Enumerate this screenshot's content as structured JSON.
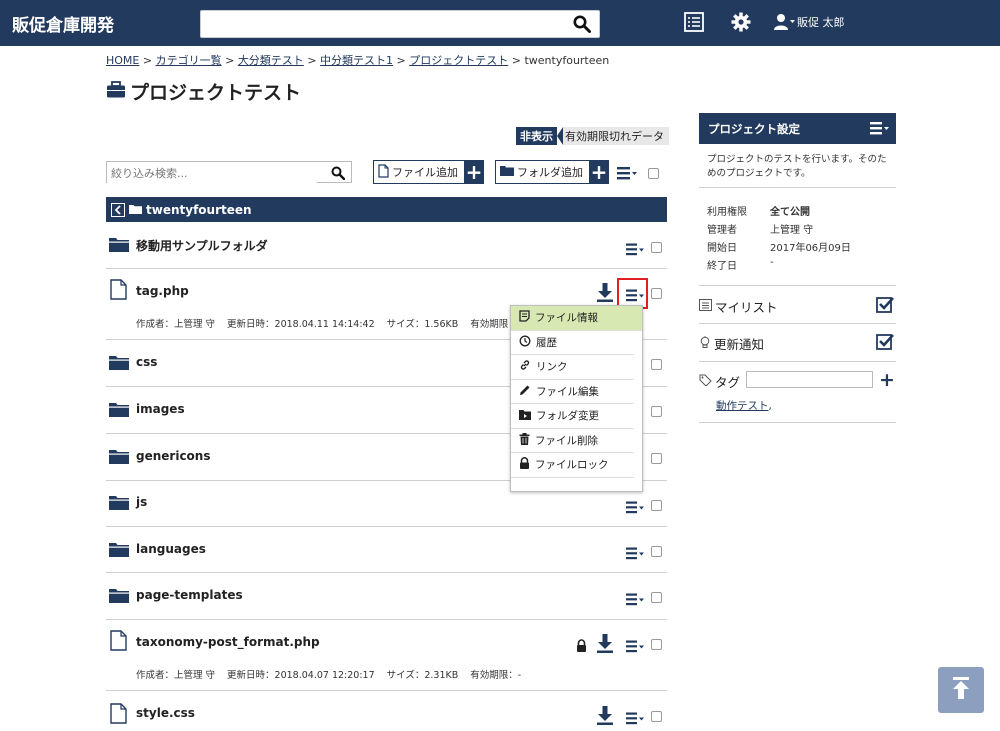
{
  "header": {
    "app_title": "販促倉庫開発",
    "search_value": "",
    "user_name": "販促 太郎"
  },
  "breadcrumb": {
    "items": [
      "HOME",
      "カテゴリ一覧",
      "大分類テスト",
      "中分類テスト1",
      "プロジェクトテスト"
    ],
    "separator": ">",
    "current": "twentyfourteen"
  },
  "page": {
    "title": "プロジェクトテスト",
    "hidden_chip_label": "非表示",
    "hidden_chip_text": "有効期限切れデータ",
    "filter_placeholder": "絞り込み検索...",
    "add_file_label": "ファイル追加",
    "add_folder_label": "フォルダ追加",
    "current_folder": "twentyfourteen"
  },
  "rows": [
    {
      "type": "folder",
      "name": "移動用サンプルフォルダ"
    },
    {
      "type": "file",
      "name": "tag.php",
      "author": "作成者：上管理 守",
      "updated": "更新日時：2018.04.11 14:14:42",
      "size": "サイズ：1.56KB",
      "expiry": "有効期限"
    },
    {
      "type": "folder",
      "name": "css"
    },
    {
      "type": "folder",
      "name": "images"
    },
    {
      "type": "folder",
      "name": "genericons"
    },
    {
      "type": "folder",
      "name": "js"
    },
    {
      "type": "folder",
      "name": "languages"
    },
    {
      "type": "folder",
      "name": "page-templates"
    },
    {
      "type": "file",
      "name": "taxonomy-post_format.php",
      "author": "作成者：上管理 守",
      "updated": "更新日時：2018.04.07 12:20:17",
      "size": "サイズ：2.31KB",
      "expiry": "有効期限：-"
    },
    {
      "type": "file",
      "name": "style.css"
    }
  ],
  "context_menu": {
    "items": [
      "ファイル情報",
      "履歴",
      "リンク",
      "ファイル編集",
      "フォルダ変更",
      "ファイル削除",
      "ファイルロック"
    ],
    "active_index": 0
  },
  "sidebar": {
    "title": "プロジェクト設定",
    "description": "プロジェクトのテストを行います。そのためのプロジェクトです。",
    "props": [
      {
        "label": "利用権限",
        "value": "全て公開"
      },
      {
        "label": "管理者",
        "value": "上管理 守"
      },
      {
        "label": "開始日",
        "value": "2017年06月09日"
      },
      {
        "label": "終了日",
        "value": "-"
      }
    ],
    "mylist_label": "マイリスト",
    "notify_label": "更新通知",
    "tag_label": "タグ",
    "tag_link": "動作テスト",
    "tag_link_suffix": ","
  },
  "colors": {
    "navy": "#223a5e",
    "highlight": "#d8e8b3",
    "annotation_red": "#e02020",
    "scroll_top": "#8d9fbf"
  }
}
